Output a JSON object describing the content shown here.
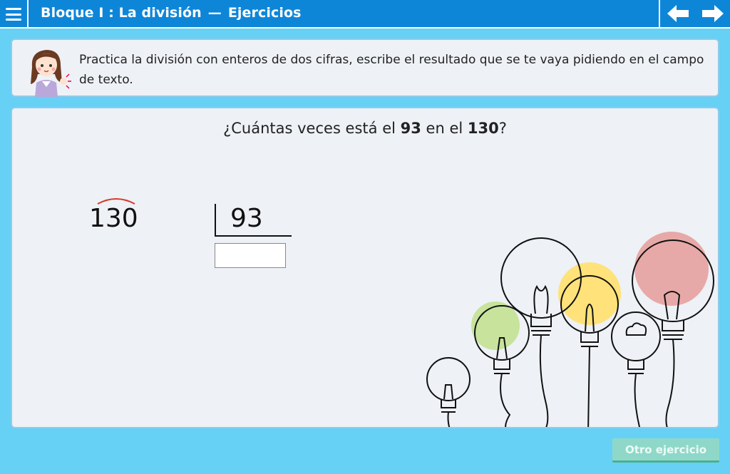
{
  "header": {
    "title_part1": "Bloque I : La división",
    "separator": "—",
    "title_part2": "Ejercicios"
  },
  "instructions": {
    "text": "Practica la división con enteros de dos cifras, escribe el resultado que se te vaya pidiendo en el campo de texto."
  },
  "exercise": {
    "question_prefix": "¿Cuántas veces está el ",
    "divisor_bold": "93",
    "question_mid": " en el ",
    "dividend_bold": "130",
    "question_suffix": "?",
    "dividend": "130",
    "divisor": "93",
    "answer_value": ""
  },
  "buttons": {
    "other_exercise": "Otro ejercicio"
  },
  "colors": {
    "header_bg": "#0e86d8",
    "page_bg": "#66d1f4",
    "panel_bg": "#eef1f6",
    "button_bg": "#8fd8c9",
    "arc_red": "#d9372b"
  },
  "icons": [
    "menu-icon",
    "arrow-left-icon",
    "arrow-right-icon",
    "teacher-avatar",
    "lightbulbs-illustration"
  ]
}
